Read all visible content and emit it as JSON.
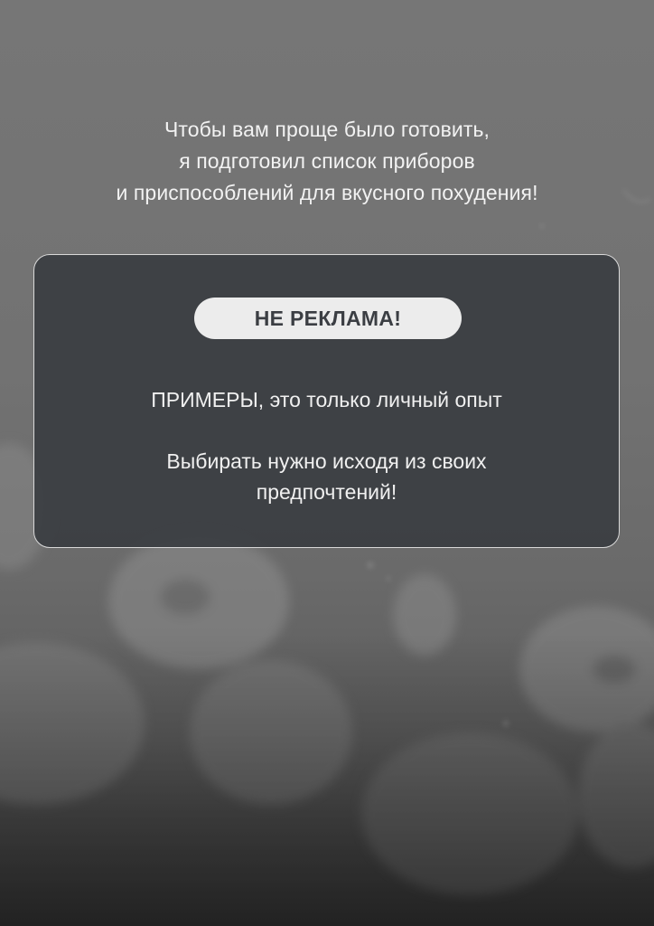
{
  "intro": {
    "lines": [
      "Чтобы вам проще было готовить,",
      "я подготовил список приборов",
      "и приспособлений для вкусного похудения!"
    ]
  },
  "card": {
    "badge": "НЕ РЕКЛАМА!",
    "note_1": "ПРИМЕРЫ, это только личный опыт",
    "note_2_lines": [
      "Выбирать нужно исходя из своих",
      "предпочтений!"
    ]
  },
  "colors": {
    "background": "#727272",
    "card": "#3a3d42",
    "card_border": "#d9d9d9",
    "badge_bg": "#ececec",
    "badge_text": "#3b3e43",
    "text": "#f2f2f2"
  }
}
